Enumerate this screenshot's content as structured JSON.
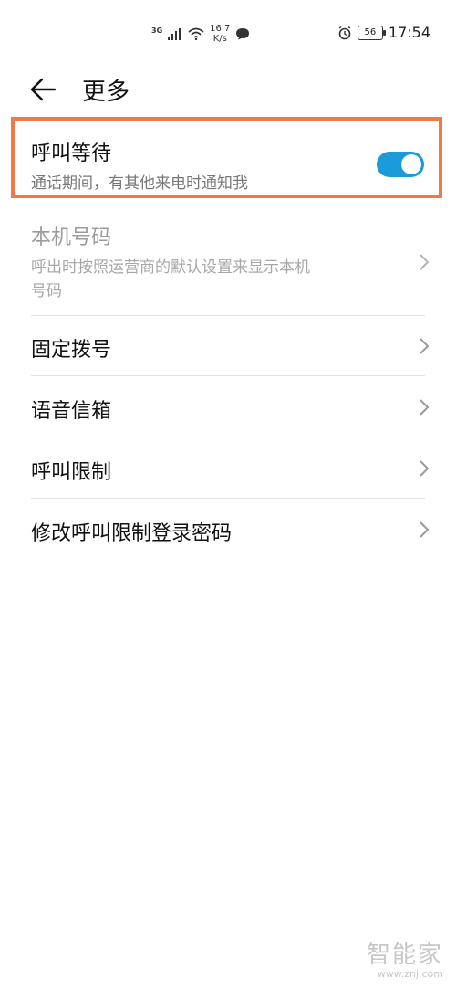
{
  "status": {
    "network": "3G",
    "speed_value": "16.7",
    "speed_unit": "K/s",
    "battery": "56",
    "time": "17:54"
  },
  "header": {
    "title": "更多"
  },
  "settings": [
    {
      "title": "呼叫等待",
      "subtitle": "通话期间，有其他来电时通知我",
      "toggle": true,
      "enabled": true,
      "highlighted": true,
      "highlight_color": "#f07a45"
    },
    {
      "title": "本机号码",
      "subtitle_line1": "呼出时按照运营商的默认设置来显示本机",
      "subtitle_line2": "号码",
      "enabled": false
    },
    {
      "title": "固定拨号",
      "enabled": true
    },
    {
      "title": "语音信箱",
      "enabled": true
    },
    {
      "title": "呼叫限制",
      "enabled": true
    },
    {
      "title": "修改呼叫限制登录密码",
      "enabled": true
    }
  ],
  "toggle_color": "#1a9ad8",
  "watermark": {
    "logo": "智能家",
    "url": "www.znj.com"
  }
}
